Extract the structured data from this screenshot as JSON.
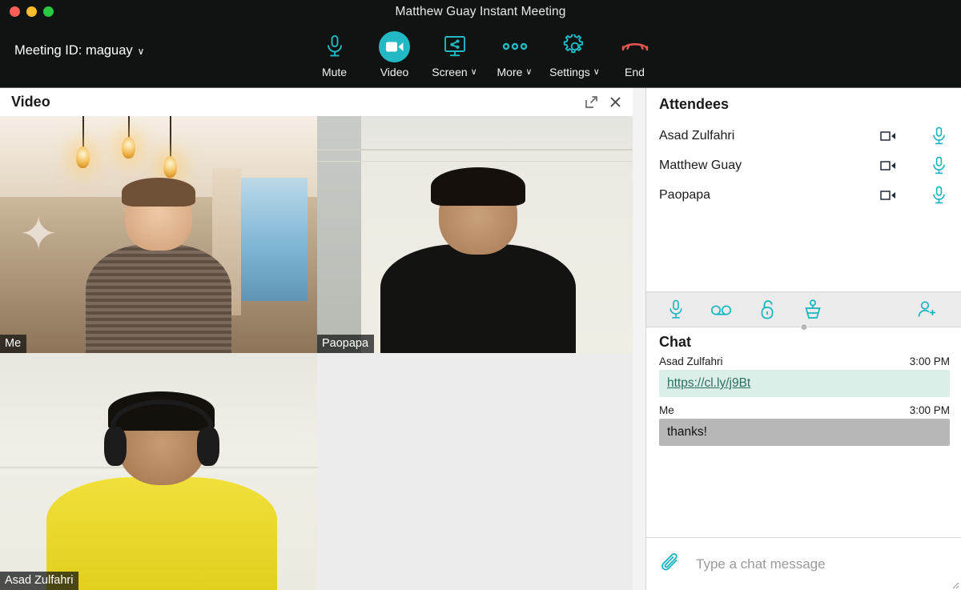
{
  "window": {
    "title": "Matthew Guay Instant Meeting",
    "traffic_lights": [
      "close",
      "minimize",
      "maximize"
    ],
    "colors": {
      "close": "#ff5f57",
      "minimize": "#febc2e",
      "maximize": "#28c840"
    }
  },
  "toolbar": {
    "meeting_id_label": "Meeting ID: maguay",
    "meeting_id_caret": "∨",
    "accent": "#22b8c4",
    "end_color": "#e8564f",
    "buttons": [
      {
        "label": "Mute",
        "icon": "microphone-icon",
        "active": false,
        "caret": ""
      },
      {
        "label": "Video",
        "icon": "video-camera-icon",
        "active": true,
        "caret": ""
      },
      {
        "label": "Screen",
        "icon": "screen-share-icon",
        "active": false,
        "caret": "∨"
      },
      {
        "label": "More",
        "icon": "more-dots-icon",
        "active": false,
        "caret": "∨"
      },
      {
        "label": "Settings",
        "icon": "gear-icon",
        "active": false,
        "caret": "∨"
      },
      {
        "label": "End",
        "icon": "hangup-phone-icon",
        "active": false,
        "caret": ""
      }
    ]
  },
  "video_panel": {
    "title": "Video",
    "actions": [
      {
        "name": "popout-icon"
      },
      {
        "name": "close-icon"
      }
    ],
    "tiles": [
      {
        "name": "Me",
        "scene": "room-pendant-lights"
      },
      {
        "name": "Paopapa",
        "scene": "pale-wall-dark-shirt"
      },
      {
        "name": "Asad Zulfahri",
        "scene": "headphones-yellow-shirt"
      },
      {
        "name": "",
        "scene": "empty"
      }
    ],
    "collapse_glyph": "»"
  },
  "attendees": {
    "title": "Attendees",
    "rows": [
      {
        "name": "Asad Zulfahri",
        "camera": "camera-icon",
        "microphone": "microphone-icon"
      },
      {
        "name": "Matthew Guay",
        "camera": "camera-icon",
        "microphone": "microphone-icon"
      },
      {
        "name": "Paopapa",
        "camera": "camera-icon",
        "microphone": "microphone-icon"
      }
    ]
  },
  "panel_toolbar": {
    "buttons": [
      {
        "name": "microphone-icon"
      },
      {
        "name": "voicemail-icon"
      },
      {
        "name": "unlock-padlock-icon"
      },
      {
        "name": "presenter-podium-icon"
      }
    ],
    "trailing": {
      "name": "add-person-icon"
    }
  },
  "chat": {
    "title": "Chat",
    "messages": [
      {
        "author": "Asad Zulfahri",
        "time": "3:00 PM",
        "text": "https://cl.ly/j9Bt",
        "is_link": true,
        "side": "other"
      },
      {
        "author": "Me",
        "time": "3:00 PM",
        "text": "thanks!",
        "is_link": false,
        "side": "me"
      }
    ],
    "input": {
      "value": "",
      "placeholder": "Type a chat message"
    },
    "attach_icon": "paperclip-icon"
  }
}
